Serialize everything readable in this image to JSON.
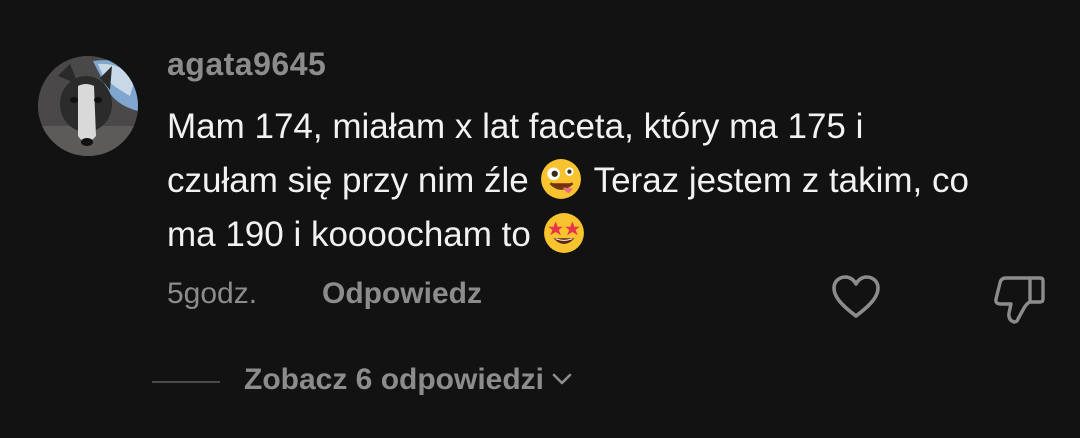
{
  "comment": {
    "username": "agata9645",
    "text_lines": [
      {
        "before": "Mam 174, miałam x lat faceta, który ma 175 i",
        "emoji": "",
        "after": ""
      },
      {
        "before": "czułam się przy nim źle ",
        "emoji": "zany-face-emoji",
        "after": " Teraz jestem z takim, co"
      },
      {
        "before": "ma 190 i koooocham to ",
        "emoji": "star-struck-emoji",
        "after": ""
      }
    ],
    "timestamp": "5godz.",
    "reply_label": "Odpowiedz",
    "view_replies_label": "Zobacz 6 odpowiedzi"
  },
  "icons": {
    "like": "heart-outline-icon",
    "dislike": "thumbs-down-outline-icon",
    "chevron": "chevron-down-icon"
  },
  "colors": {
    "background": "#121212",
    "text": "#f2f2f2",
    "muted": "#8c8c8c"
  }
}
